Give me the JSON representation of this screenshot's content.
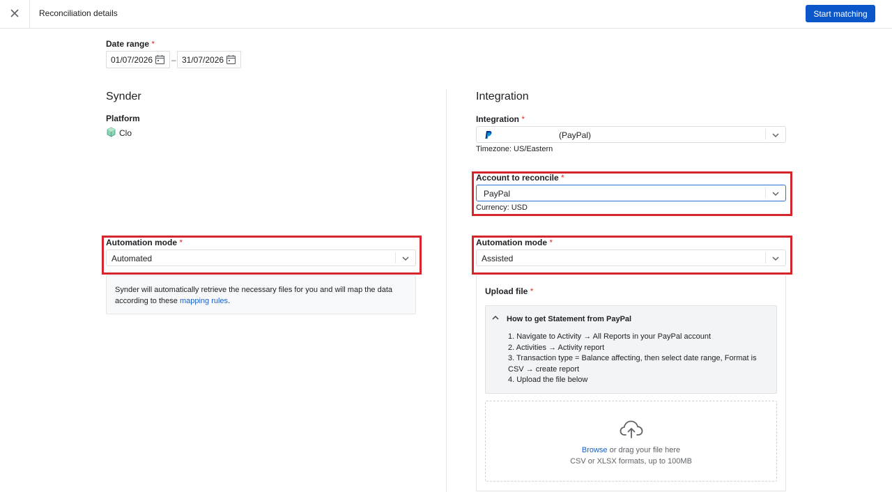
{
  "header": {
    "title": "Reconciliation details",
    "start_button": "Start matching"
  },
  "date_range": {
    "label": "Date range",
    "required": "*",
    "from": "01/07/2026",
    "dash": "–",
    "to": "31/07/2026"
  },
  "left": {
    "title": "Synder",
    "platform_label": "Platform",
    "platform_value": "Clo",
    "automation_label": "Automation mode",
    "automation_required": "*",
    "automation_value": "Automated",
    "info_text": "Synder will automatically retrieve the necessary files for you and will map the data according to these ",
    "info_link": "mapping rules",
    "info_end": "."
  },
  "right": {
    "title": "Integration",
    "integration_label": "Integration",
    "integration_required": "*",
    "integration_value": "(PayPal)",
    "timezone": "Timezone: US/Eastern",
    "account_label": "Account to reconcile",
    "account_required": "*",
    "account_value": "PayPal",
    "currency": "Currency: USD",
    "automation_label": "Automation mode",
    "automation_required": "*",
    "automation_value": "Assisted",
    "upload_label": "Upload file",
    "upload_required": "*",
    "howto_title": "How to get Statement from PayPal",
    "steps": [
      "1. Navigate to Activity → All Reports in your PayPal account",
      "2. Activities → Activity report",
      "3. Transaction type = Balance affecting, then select date range, Format is CSV → create report",
      "4. Upload the file below"
    ],
    "browse_link": "Browse",
    "drag_text": " or drag your file here",
    "formats": "CSV or XLSX formats, up to 100MB"
  },
  "colors": {
    "primary": "#0b57c9",
    "highlight": "#d7262b",
    "required": "#d93025",
    "link": "#1a5fc8"
  }
}
